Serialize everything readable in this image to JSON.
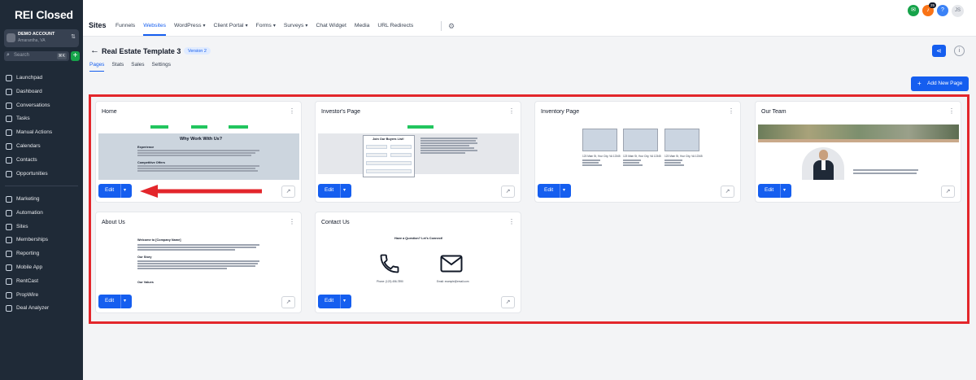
{
  "app": {
    "logo": "REI Closed",
    "account": {
      "name": "DEMO ACCOUNT",
      "location": "Amarantha, VA"
    },
    "search": {
      "placeholder": "Search",
      "shortcut": "⌘K"
    }
  },
  "sidebar": {
    "items": [
      {
        "label": "Launchpad",
        "icon": "rocket-icon"
      },
      {
        "label": "Dashboard",
        "icon": "dashboard-icon"
      },
      {
        "label": "Conversations",
        "icon": "chat-icon"
      },
      {
        "label": "Tasks",
        "icon": "tasks-icon"
      },
      {
        "label": "Manual Actions",
        "icon": "manual-actions-icon"
      },
      {
        "label": "Calendars",
        "icon": "calendar-icon"
      },
      {
        "label": "Contacts",
        "icon": "contacts-icon"
      },
      {
        "label": "Opportunities",
        "icon": "opportunities-icon"
      }
    ],
    "items2": [
      {
        "label": "Marketing",
        "icon": "marketing-icon"
      },
      {
        "label": "Automation",
        "icon": "automation-icon"
      },
      {
        "label": "Sites",
        "icon": "sites-icon"
      },
      {
        "label": "Memberships",
        "icon": "memberships-icon"
      },
      {
        "label": "Reporting",
        "icon": "reporting-icon"
      },
      {
        "label": "Mobile App",
        "icon": "mobile-app-icon"
      },
      {
        "label": "RentCast",
        "icon": "rentcast-icon"
      },
      {
        "label": "PropWire",
        "icon": "propwire-icon"
      },
      {
        "label": "Deal Analyzer",
        "icon": "deal-analyzer-icon"
      }
    ]
  },
  "topnav": {
    "title": "Sites",
    "tabs": [
      {
        "label": "Funnels",
        "dropdown": false
      },
      {
        "label": "Websites",
        "dropdown": false,
        "active": true
      },
      {
        "label": "WordPress",
        "dropdown": true
      },
      {
        "label": "Client Portal",
        "dropdown": true
      },
      {
        "label": "Forms",
        "dropdown": true
      },
      {
        "label": "Surveys",
        "dropdown": true
      },
      {
        "label": "Chat Widget",
        "dropdown": false
      },
      {
        "label": "Media",
        "dropdown": false
      },
      {
        "label": "URL Redirects",
        "dropdown": false
      }
    ],
    "notification_count": "25",
    "avatar_initials": "JS"
  },
  "page": {
    "title": "Real Estate Template 3",
    "version": "Version 2",
    "subtabs": [
      "Pages",
      "Stats",
      "Sales",
      "Settings"
    ],
    "add_page_label": "Add New Page"
  },
  "cards": [
    {
      "title": "Home",
      "edit_label": "Edit"
    },
    {
      "title": "Investor's Page",
      "edit_label": "Edit"
    },
    {
      "title": "Inventory Page",
      "edit_label": "Edit"
    },
    {
      "title": "Our Team",
      "edit_label": "Edit"
    },
    {
      "title": "About Us",
      "edit_label": "Edit"
    },
    {
      "title": "Contact Us",
      "edit_label": "Edit"
    }
  ],
  "thumbnails": {
    "home_heading": "Why Work With Us?",
    "home_sub1": "Experience",
    "home_sub2": "Competitive Offers",
    "investor_form_title": "Join Our Buyers List!",
    "inventory_caption": "123 Main St, Your City, VA 12345",
    "about_heading": "Welcome to [Company Name]",
    "about_sub1": "Our Story",
    "about_sub2": "Our Values",
    "contact_heading": "Have a Question? Let's Connect!",
    "contact_phone": "Phone: (123) 456-7890",
    "contact_email": "Email: example@email.com"
  },
  "colors": {
    "accent": "#155eef",
    "sidebar_bg": "#1f2a37",
    "highlight": "#e3262b"
  }
}
